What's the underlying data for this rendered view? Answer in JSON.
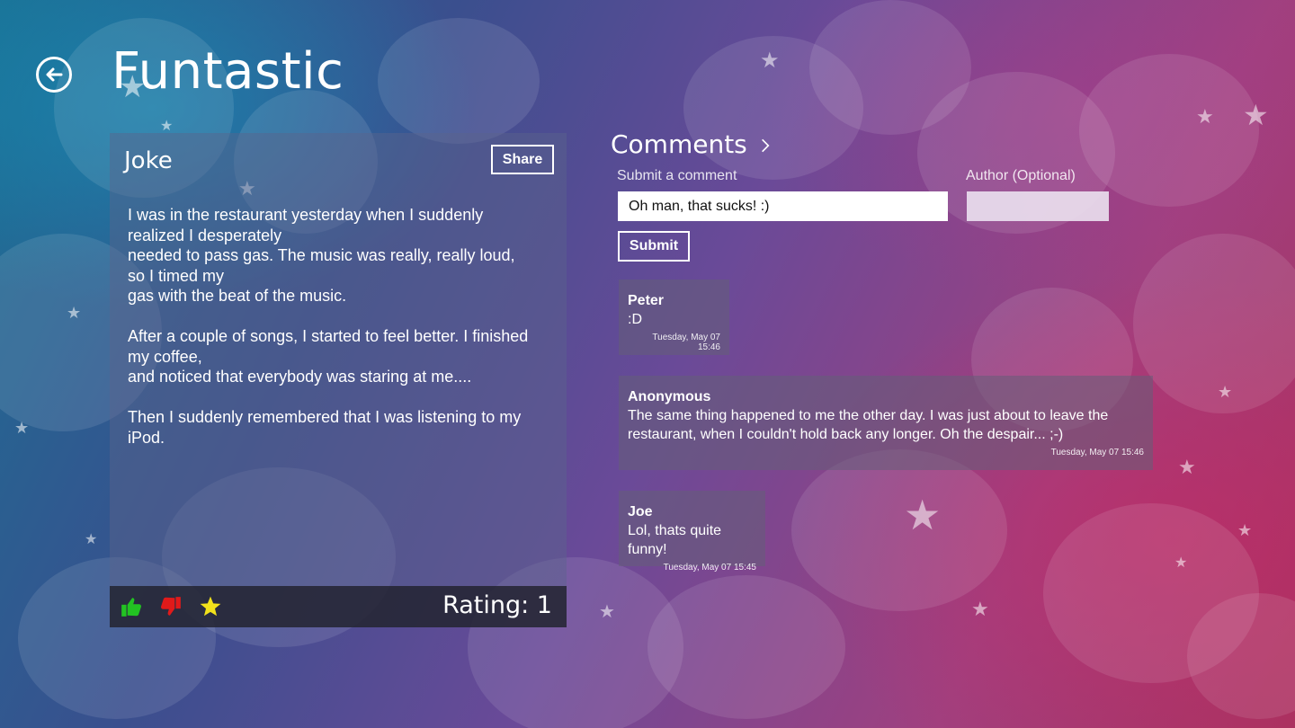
{
  "header": {
    "title": "Funtastic",
    "back_icon": "back-arrow-icon"
  },
  "joke": {
    "heading": "Joke",
    "share_label": "Share",
    "text": "I was in the restaurant yesterday when I suddenly realized I desperately\nneeded to pass gas. The music was really, really loud, so I timed my\ngas with the beat of the music.\n\nAfter a couple of songs, I started to feel better. I finished my coffee,\nand noticed that everybody was staring at me....\n\nThen I suddenly remembered that I was listening to my iPod.",
    "rating_label": "Rating: 1",
    "icons": {
      "like": "thumbs-up-icon",
      "dislike": "thumbs-down-icon",
      "favorite": "star-icon"
    },
    "colors": {
      "like": "#22c322",
      "dislike": "#e01a1a",
      "favorite": "#f2e21b"
    }
  },
  "comments": {
    "title": "Comments",
    "title_icon": "chevron-right-icon",
    "submit_label": "Submit a comment",
    "author_label": "Author (Optional)",
    "comment_value": "Oh man, that sucks! :)",
    "author_value": "",
    "submit_button": "Submit",
    "items": [
      {
        "author": "Peter",
        "text": ":D",
        "time": "Tuesday, May 07 15:46"
      },
      {
        "author": "Anonymous",
        "text": "The same thing happened to me the other day. I was just about to leave the restaurant, when I couldn't hold back any longer. Oh the despair... ;-)",
        "time": "Tuesday, May 07 15:46"
      },
      {
        "author": "Joe",
        "text": "Lol, thats quite funny!",
        "time": "Tuesday, May 07 15:45"
      }
    ]
  }
}
